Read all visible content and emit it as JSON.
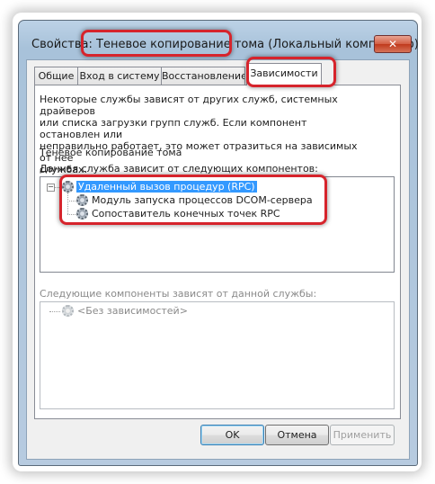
{
  "window": {
    "title": "Свойства: Теневое копирование тома (Локальный компьютер)",
    "close_label": "✕"
  },
  "tabs": [
    "Общие",
    "Вход в систему",
    "Восстановление",
    "Зависимости"
  ],
  "dependencies": {
    "description": "Некоторые службы зависят от других служб, системных драйверов\nили списка загрузки групп служб. Если компонент остановлен или\nнеправильно работает, это может отразиться на зависимых от нее\nслужбах.",
    "service_name": "Теневое копирование тома",
    "depends_on_label": "Данная служба зависит от следующих компонентов:",
    "depends_on_tree": {
      "root": "Удаленный вызов процедур (RPC)",
      "root_expander": "−",
      "children": [
        "Модуль запуска процессов DCOM-сервера",
        "Сопоставитель конечных точек RPC"
      ]
    },
    "dependents_label": "Следующие компоненты зависят от данной службы:",
    "dependents_tree": {
      "item": "<Без зависимостей>"
    }
  },
  "buttons": {
    "ok": "OK",
    "cancel": "Отмена",
    "apply": "Применить"
  },
  "colors": {
    "highlight": "#d6242c",
    "selection": "#3399ff"
  }
}
